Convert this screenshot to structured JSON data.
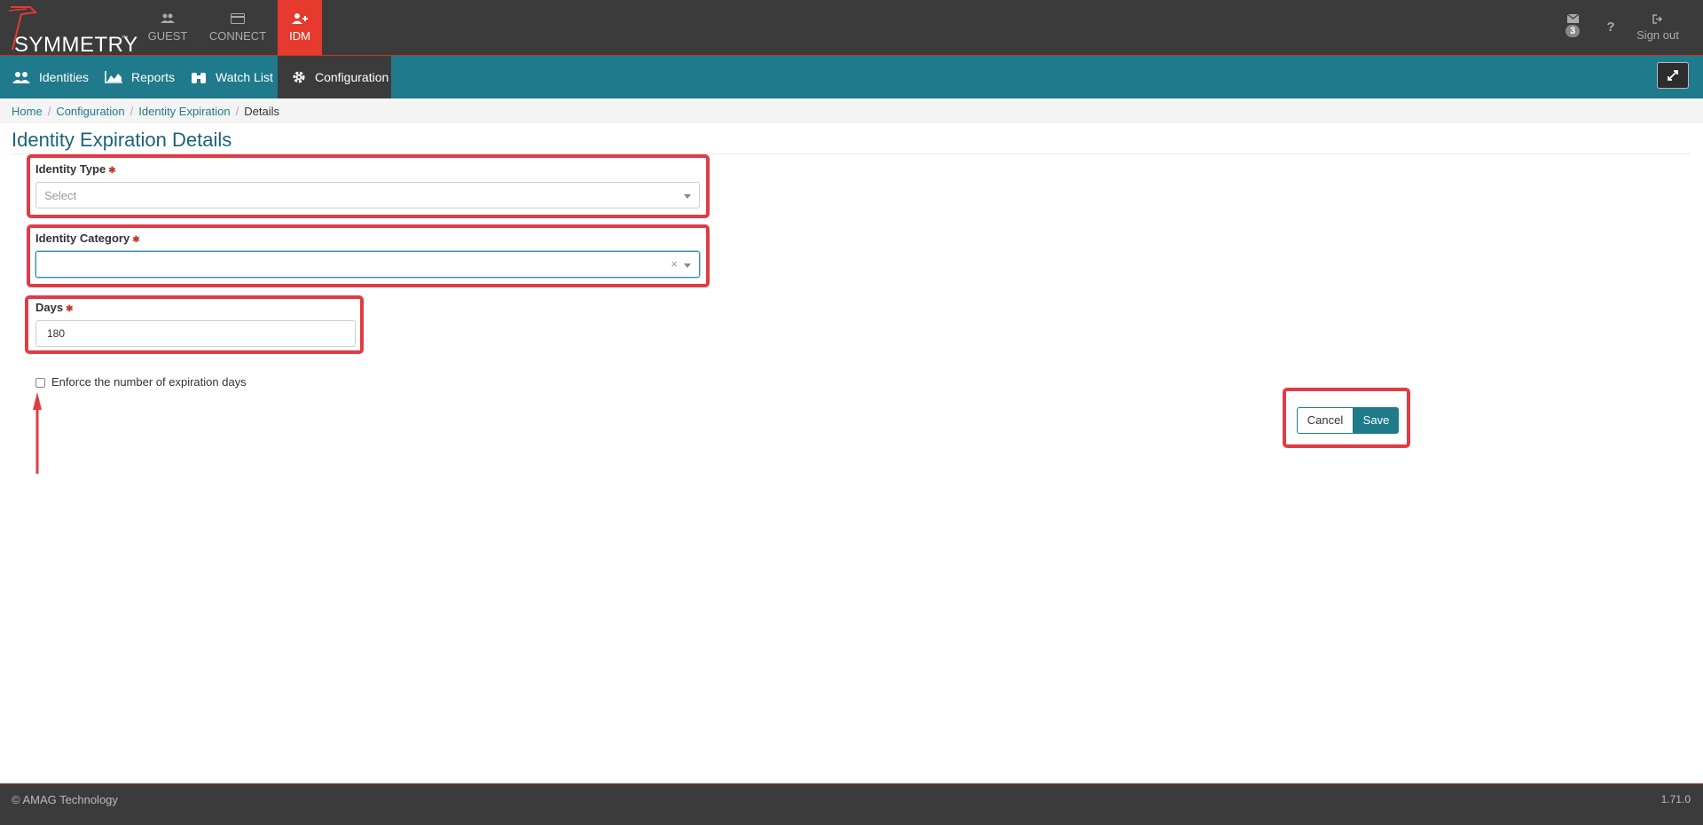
{
  "header": {
    "logo_text": "SYMMETRY",
    "logo_tm": "™",
    "modules": [
      {
        "label": "GUEST",
        "icon": "users-icon"
      },
      {
        "label": "CONNECT",
        "icon": "card-icon"
      },
      {
        "label": "IDM",
        "icon": "user-plus-icon",
        "active": true
      }
    ],
    "mail_count": "3",
    "help_label": "?",
    "signout_label": "Sign out"
  },
  "nav": {
    "items": [
      {
        "label": "Identities",
        "icon": "users-icon"
      },
      {
        "label": "Reports",
        "icon": "chart-area-icon"
      },
      {
        "label": "Watch List",
        "icon": "binoculars-icon"
      },
      {
        "label": "Configuration",
        "icon": "gear-icon",
        "active": true
      }
    ]
  },
  "breadcrumb": {
    "items": [
      "Home",
      "Configuration",
      "Identity Expiration"
    ],
    "current": "Details",
    "separator": "/"
  },
  "page": {
    "title": "Identity Expiration Details"
  },
  "form": {
    "required_mark": "✱",
    "identity_type": {
      "label": "Identity Type",
      "placeholder": "Select",
      "value": ""
    },
    "identity_category": {
      "label": "Identity Category",
      "value": "",
      "clear": "×"
    },
    "days": {
      "label": "Days",
      "value": "180"
    },
    "enforce": {
      "label": "Enforce the number of expiration days",
      "checked": false
    },
    "cancel_label": "Cancel",
    "save_label": "Save"
  },
  "footer": {
    "copyright": "© AMAG Technology",
    "version": "1.71.0"
  },
  "colors": {
    "topbar": "#3b3b3b",
    "accent_red": "#e63a2f",
    "nav_teal": "#1f7a8c",
    "highlight": "#e03c45"
  }
}
